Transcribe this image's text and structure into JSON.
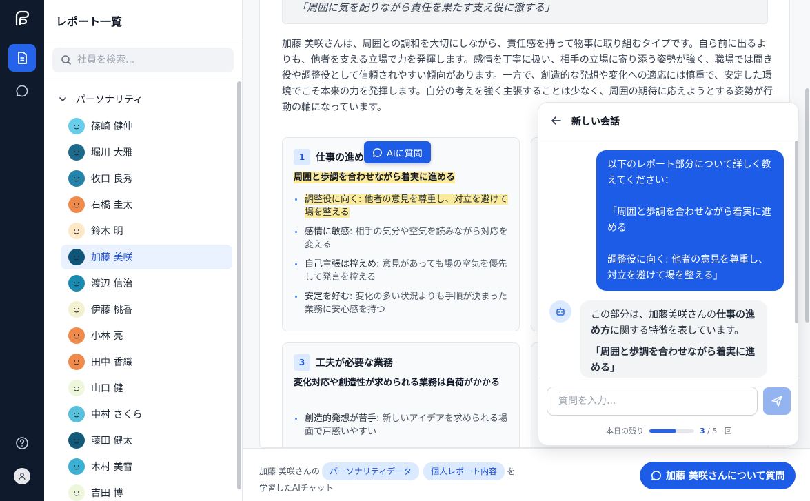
{
  "sidebar": {
    "title": "レポート一覧",
    "search_placeholder": "社員を検索...",
    "section": "パーソナリティ",
    "people": [
      {
        "name": "篠崎 健伸",
        "color": "#67cde8"
      },
      {
        "name": "堀川 大雅",
        "color": "#1e6a8a"
      },
      {
        "name": "牧口 良秀",
        "color": "#2383a8"
      },
      {
        "name": "石橋 圭太",
        "color": "#f08a4b"
      },
      {
        "name": "鈴木 明",
        "color": "#fde8c8"
      },
      {
        "name": "加藤 美咲",
        "color": "#0f5577",
        "active": true
      },
      {
        "name": "渡辺 信治",
        "color": "#1a8ab0"
      },
      {
        "name": "伊藤 桃香",
        "color": "#f4f1d0"
      },
      {
        "name": "小林 亮",
        "color": "#f08a4b"
      },
      {
        "name": "田中 香織",
        "color": "#f08a4b"
      },
      {
        "name": "山口 健",
        "color": "#eef6dc"
      },
      {
        "name": "中村 さくら",
        "color": "#58c2dc"
      },
      {
        "name": "藤田 健太",
        "color": "#135a7a"
      },
      {
        "name": "木村 美雪",
        "color": "#3ab0d4"
      },
      {
        "name": "吉田 博",
        "color": "#eef6dc"
      }
    ]
  },
  "report": {
    "quote": "「周囲に気を配りながら責任を果たす支え役に徹する」",
    "summary": "加藤 美咲さんは、周囲との調和を大切にしながら、責任感を持って物事に取り組むタイプです。自ら前に出るよりも、他者を支える立場で力を発揮します。感情を丁寧に扱い、相手の立場に寄り添う姿勢が強く、職場では聞き役や調整役として信頼されやすい傾向があります。一方で、創造的な発想や変化への適応には慎重で、安定した環境でこそ本来の力を発揮します。自分の考えを強く主張することは少なく、周囲の期待に応えようとする姿勢が行動の軸になっています。",
    "card1": {
      "num": "1",
      "title": "仕事の進め方",
      "subtitle": "周囲と歩調を合わせながら着実に進める",
      "items": [
        {
          "head": "調整役に向く",
          "text": ": 他者の意見を尊重し、対立を避けて場を整える"
        },
        {
          "head": "感情に敏感",
          "text": ": 相手の気分や空気を読みながら対応を変える"
        },
        {
          "head": "自己主張は控えめ",
          "text": ": 意見があっても場の空気を優先して発言を控える"
        },
        {
          "head": "安定を好む",
          "text": ": 変化の多い状況よりも手順が決まった業務に安心感を持つ"
        }
      ]
    },
    "card3": {
      "num": "3",
      "title": "工夫が必要な業務",
      "subtitle": "変化対応や創造性が求められる業務は負荷がかかる",
      "items": [
        {
          "head": "創造的発想が苦手",
          "text": ": 新しいアイデアを求められる場面で戸惑いやすい"
        }
      ]
    },
    "ai_ask_label": "AIに質問"
  },
  "bottombar": {
    "prefix": "加藤 美咲さんの",
    "chip1": "パーソナリティデータ",
    "chip2": "個人レポート内容",
    "suffix": "を",
    "line2": "学習したAIチャット",
    "ask_button": "加藤 美咲さんについて質問"
  },
  "chat": {
    "title": "新しい会話",
    "user_p1": "以下のレポート部分について詳しく教えてください：",
    "user_p2": "「周囲と歩調を合わせながら着実に進める",
    "user_p3": "調整役に向く: 他者の意見を尊重し、対立を避けて場を整える」",
    "bot_pre": "この部分は、加藤美咲さんの",
    "bot_bold": "仕事の進め方",
    "bot_post": "に関する特徴を表しています。",
    "bot_p2": "「周囲と歩調を合わせながら着実に進める」",
    "input_placeholder": "質問を入力...",
    "remain_label": "本日の残り",
    "remain_count": "3",
    "remain_total": "5",
    "remain_unit": "回",
    "remain_fraction": 0.6
  }
}
